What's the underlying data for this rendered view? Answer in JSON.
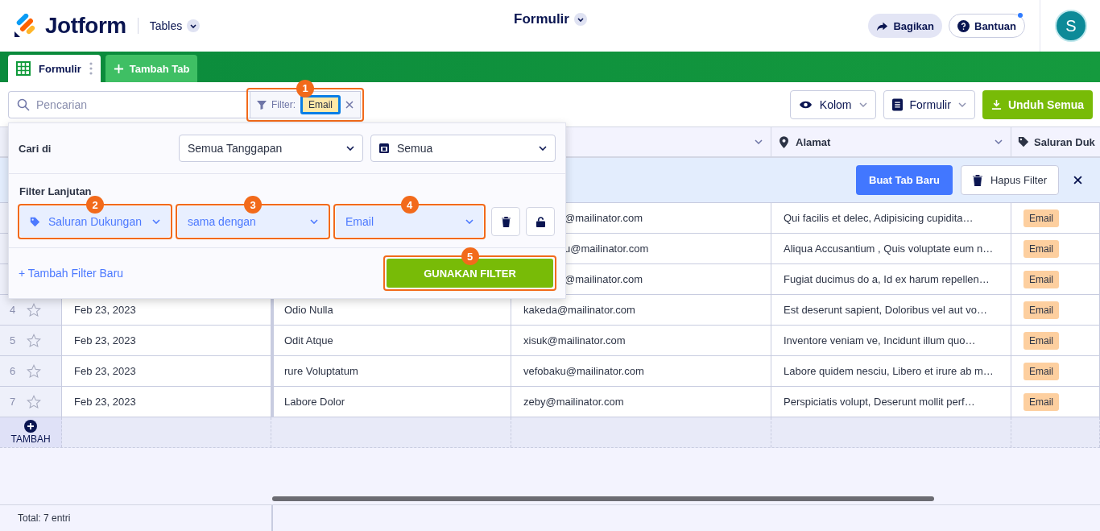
{
  "header": {
    "logo": "Jotform",
    "app_menu": "Tables",
    "title": "Formulir",
    "share": "Bagikan",
    "help": "Bantuan",
    "help_notification": true,
    "avatar": "S"
  },
  "tabs": [
    {
      "label": "Formulir",
      "selected": true
    }
  ],
  "add_tab": "Tambah Tab",
  "toolbar": {
    "search_placeholder": "Pencarian",
    "filter_label": "Filter:",
    "filter_chip": "Email",
    "columns_button": "Kolom",
    "form_button": "Formulir",
    "download_button": "Unduh Semua"
  },
  "table": {
    "columns": [
      {
        "label": "Alamat",
        "kind": "address"
      },
      {
        "label": "Saluran Duk",
        "kind": "tag"
      }
    ],
    "banner": {
      "create_tab": "Buat Tab Baru",
      "clear_filter": "Hapus Filter"
    },
    "rows": [
      {
        "email": "@mailinator.com",
        "address": "Qui facilis et delec, Adipisicing cupidita…",
        "channel": "Email"
      },
      {
        "email": "u@mailinator.com",
        "address": "Aliqua Accusantium , Quis voluptate eum n…",
        "channel": "Email"
      },
      {
        "email": "@mailinator.com",
        "address": "Fugiat ducimus do a, Id ex harum repellen…",
        "channel": "Email"
      },
      {
        "number": "4",
        "starred": false,
        "date": "Feb 23, 2023",
        "name": "Odio Nulla",
        "email": "kakeda@mailinator.com",
        "address": "Est deserunt sapient, Doloribus vel aut vo…",
        "channel": "Email"
      },
      {
        "number": "5",
        "starred": false,
        "date": "Feb 23, 2023",
        "name": "Odit Atque",
        "email": "xisuk@mailinator.com",
        "address": "Inventore veniam ve, Incidunt illum quo…",
        "channel": "Email"
      },
      {
        "number": "6",
        "starred": false,
        "date": "Feb 23, 2023",
        "name": "rure Voluptatum",
        "email": "vefobaku@mailinator.com",
        "address": "Labore quidem nesciu, Libero et irure ab m…",
        "channel": "Email"
      },
      {
        "number": "7",
        "starred": false,
        "date": "Feb 23, 2023",
        "name": "Labore Dolor",
        "email": "zeby@mailinator.com",
        "address": "Perspiciatis volupt, Deserunt mollit perf…",
        "channel": "Email"
      }
    ],
    "add_row": "TAMBAH",
    "footer": "Total: 7 entri"
  },
  "filter_panel": {
    "search_in_label": "Cari di",
    "scope": "Semua Tanggapan",
    "date": "Semua",
    "advanced_label": "Filter Lanjutan",
    "field": "Saluran Dukungan",
    "operator": "sama dengan",
    "value": "Email",
    "add_filter": "+ Tambah Filter Baru",
    "apply": "GUNAKAN FILTER"
  },
  "callouts": [
    "1",
    "2",
    "3",
    "4",
    "5"
  ]
}
